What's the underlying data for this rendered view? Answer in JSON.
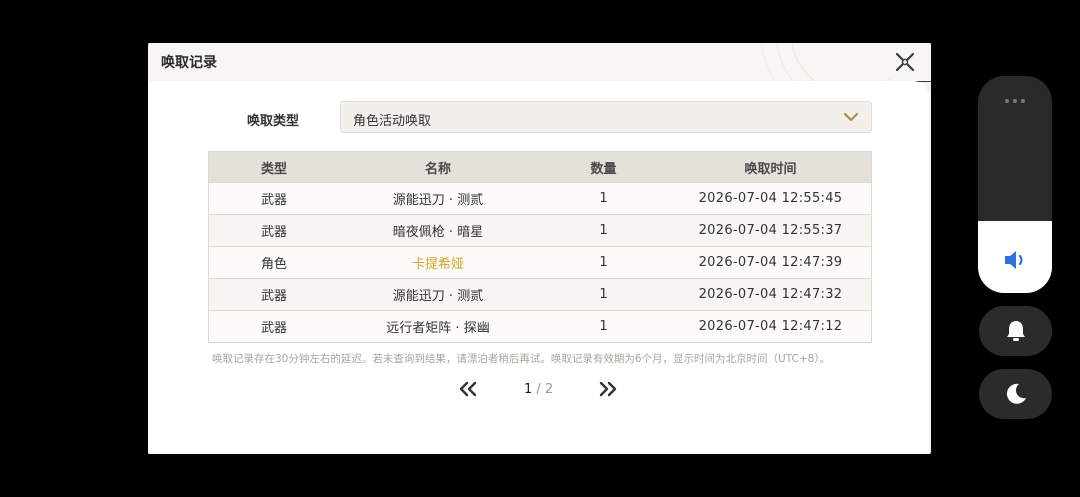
{
  "dialog": {
    "title": "唤取记录",
    "type_label": "唤取类型",
    "select_value": "角色活动唤取",
    "columns": [
      "类型",
      "名称",
      "数量",
      "唤取时间"
    ],
    "rows": [
      {
        "type": "武器",
        "name": "源能迅刀 · 测贰",
        "qty": "1",
        "time": "2026-07-04 12:55:45",
        "highlight": false
      },
      {
        "type": "武器",
        "name": "暗夜佩枪 · 暗星",
        "qty": "1",
        "time": "2026-07-04 12:55:37",
        "highlight": false
      },
      {
        "type": "角色",
        "name": "卡提希娅",
        "qty": "1",
        "time": "2026-07-04 12:47:39",
        "highlight": true
      },
      {
        "type": "武器",
        "name": "源能迅刀 · 测贰",
        "qty": "1",
        "time": "2026-07-04 12:47:32",
        "highlight": false
      },
      {
        "type": "武器",
        "name": "远行者矩阵 · 探幽",
        "qty": "1",
        "time": "2026-07-04 12:47:12",
        "highlight": false
      }
    ],
    "note": "唤取记录存在30分钟左右的延迟。若未查询到结果，请漂泊者稍后再试。唤取记录有效期为6个月，显示时间为北京时间（UTC+8）。",
    "pagination": {
      "current": "1",
      "separator_total": " / 2"
    }
  },
  "colors": {
    "highlight": "#d4a52a",
    "accent": "#2f6fe0"
  },
  "icons": {
    "close": "close-x-icon",
    "select": "chevron-down-icon",
    "prev": "double-chevron-left-icon",
    "next": "double-chevron-right-icon",
    "volume": "speaker-icon",
    "bell": "bell-icon",
    "moon": "moon-icon"
  },
  "volume_overlay": {
    "level": 0.33
  }
}
